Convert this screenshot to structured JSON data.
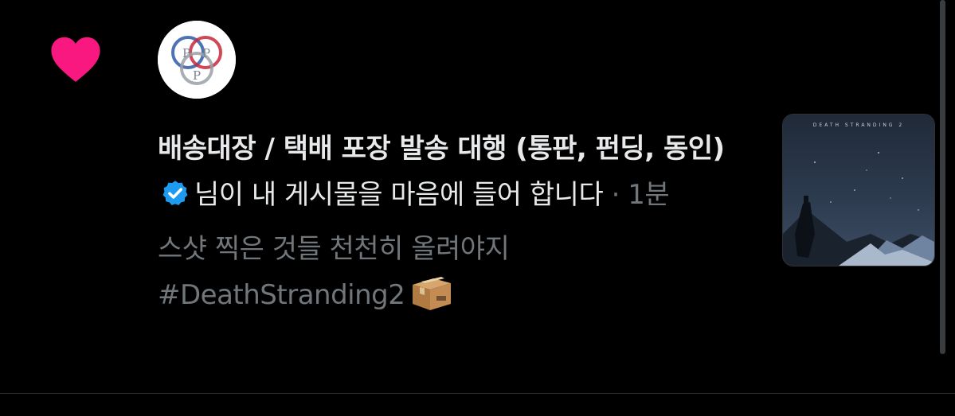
{
  "notification": {
    "type_icon": "heart-icon",
    "avatar_icon": "ppp-logo",
    "avatar_logo_letters": [
      "P",
      "P",
      "P"
    ],
    "display_name": "배송대장 / 택배 포장 발송 대행 (통판, 펀딩, 동인)",
    "verified_icon": "verified-badge-icon",
    "action_text": "님이 내 게시물을 마음에 들어 합니다",
    "separator": "·",
    "time": "1분",
    "tweet_text": "스샷 찍은 것들 천천히 올려야지",
    "hashtag": "#DeathStranding2",
    "hashtag_emoji_icon": "package-icon",
    "thumbnail_icon": "death-stranding-2-artwork",
    "thumbnail_title": "DEATH STRANDING 2"
  },
  "colors": {
    "background": "#000000",
    "heart": "#f91880",
    "verified": "#1d9bf0",
    "primary_text": "#e7e9ea",
    "secondary_text": "#71767b",
    "divider": "#2f3336"
  }
}
